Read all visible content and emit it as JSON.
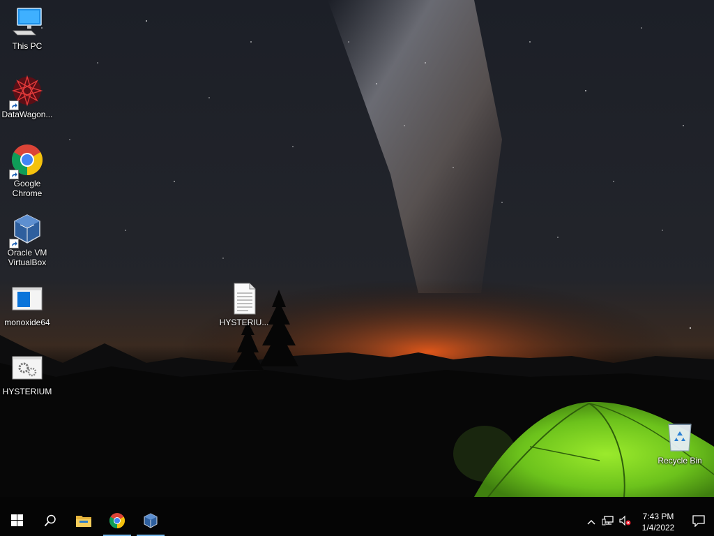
{
  "desktop": {
    "icons": [
      {
        "label": "This PC"
      },
      {
        "label": "DataWagon..."
      },
      {
        "label": "Google Chrome"
      },
      {
        "label": "Oracle VM VirtualBox"
      },
      {
        "label": "monoxide64"
      },
      {
        "label": "HYSTERIUM"
      },
      {
        "label": "HYSTERIU..."
      },
      {
        "label": "Recycle Bin"
      }
    ]
  },
  "taskbar": {
    "start_icon": "windows-logo-icon",
    "search_icon": "search-icon",
    "pinned": [
      {
        "name": "file-explorer-icon",
        "running": false
      },
      {
        "name": "chrome-icon",
        "running": true
      },
      {
        "name": "virtualbox-icon",
        "running": true
      }
    ]
  },
  "tray": {
    "time": "7:43 PM",
    "date": "1/4/2022",
    "icons": [
      "chevron-up-icon",
      "network-icon",
      "volume-muted-icon",
      "action-center-icon"
    ]
  },
  "colors": {
    "taskbar_bg": "#050505",
    "running_indicator": "#76b9ed",
    "tent_green": "#7ed321"
  }
}
